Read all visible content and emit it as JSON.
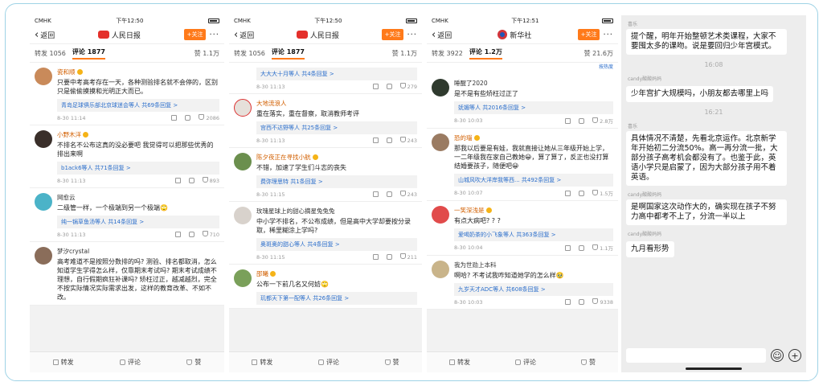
{
  "panels": [
    {
      "status": {
        "carrier": "CMHK",
        "time": "下午12:50"
      },
      "nav": {
        "back": "返回",
        "title": "人民日报",
        "follow": "+关注",
        "more": "···"
      },
      "tabs": {
        "repost": "转发 1056",
        "comment": "评论 1877",
        "likes": "赞 1.1万"
      },
      "comments": [
        {
          "user": "瓷和顺",
          "text": "只要中考高考存在一天，各种测验排名就不会停的，区别只是偷偷摸摸和光明正大而已。",
          "replies": "青岛足球俱乐部北京球迷会等人 共69条回复 >",
          "time": "8-30 11:14",
          "likes": "2086",
          "avatar": "#c98a5a"
        },
        {
          "user": "小野木洋",
          "text": "不排名不公布这真的没必要吧 我觉得可以把那些优秀的排出来啊",
          "replies": "b1ack6等人 共71条回复 >",
          "time": "8-30 11:13",
          "likes": "893",
          "avatar": "#3a2f2a"
        },
        {
          "user": "网愈云",
          "text": "二级管一样，一个极端到另一个极端🙄",
          "replies": "纯一锅草鱼汤等人 共14条回复 >",
          "time": "8-30 11:13",
          "likes": "710",
          "avatar": "#4bb3c8"
        },
        {
          "user": "梦汐crystal",
          "text": "高考难道不是按照分数排的吗? 测验、排名都取消，怎么知道学生学得怎么样，仅靠期末考试吗? 期末考试成绩不理想，自行假期疯狂补课吗? 矫枉过正，越减越烈，完全不按实际情况实际需求出发，这样的教育改革、不如不改。",
          "replies": "",
          "time": "",
          "likes": "",
          "avatar": "#8a6d5a"
        }
      ],
      "bottom": {
        "repost": "转发",
        "comment": "评论",
        "like": "赞"
      }
    },
    {
      "status": {
        "carrier": "CMHK",
        "time": "下午12:50"
      },
      "nav": {
        "back": "返回",
        "title": "人民日报",
        "follow": "+关注",
        "more": "···"
      },
      "tabs": {
        "repost": "转发 1056",
        "comment": "评论 1877",
        "likes": "赞 1.1万"
      },
      "comments": [
        {
          "user": "",
          "text": "",
          "replies": "大大大十月等人 共4条回复 >",
          "time": "8-30 11:13",
          "likes": "279",
          "avatar": ""
        },
        {
          "user": "大地流浪人",
          "text": "重在落实，重在督察，取消教师考评",
          "replies": "宫西不达野等人 共25条回复 >",
          "time": "8-30 11:13",
          "likes": "243",
          "avatar": "#e6e0da"
        },
        {
          "user": "陈夕夜正在寻找小航",
          "text": "不错，加速了学生们斗志的丧失",
          "replies": "费弥理思特 共1条回复 >",
          "time": "8-30 11:15",
          "likes": "243",
          "avatar": "#6b8f4e"
        },
        {
          "user": "玫瑰星球上的甜心摘星兔兔兔",
          "text": "中小学不排名，不公布成绩，但是高中大学却要按分录取，稀里糊涂上学吗?",
          "replies": "奥斑奥的甜心等人 共4条回复 >",
          "time": "8-30 11:15",
          "likes": "211",
          "avatar": "#d8d2cc"
        },
        {
          "user": "邵曦",
          "text": "公布一下前几名又何妨🙄",
          "replies": "玑都天下第一配等人 共26条回复 >",
          "time": "",
          "likes": "",
          "avatar": "#7aa05a"
        }
      ],
      "bottom": {
        "repost": "转发",
        "comment": "评论",
        "like": "赞"
      }
    },
    {
      "status": {
        "carrier": "CMHK",
        "time": "下午12:51"
      },
      "nav": {
        "back": "返回",
        "title": "新华社",
        "follow": "+关注",
        "more": "···"
      },
      "tabs": {
        "repost": "转发 3922",
        "comment": "评论 1.2万",
        "likes": "赞 21.6万"
      },
      "sort": "按热度",
      "comments": [
        {
          "user": "睡醒了2020",
          "text": "是不是有些矫枉过正了",
          "replies": "妩媚等人 共2016条回复 >",
          "time": "8-30 10:03",
          "likes": "2.8万",
          "avatar": "#2f3a2e"
        },
        {
          "user": "恐的瑙",
          "text": "那我以后要是有娃，我就直接让她从三年级开始上学，一二年级我在家自己教她😀，算了算了，反正也没打算结婚要孩子，随便吧😀",
          "replies": "山城风吹大洋岸我等西... 共492条回复 >",
          "time": "8-30 10:07",
          "likes": "1.5万",
          "avatar": "#9a7b62"
        },
        {
          "user": "一笑深浅是",
          "text": "有点大病吧? ? ?",
          "replies": "爱喝奶茶的小飞象等人 共363条回复 >",
          "time": "8-30 10:04",
          "likes": "1.1万",
          "avatar": "#e14b4b"
        },
        {
          "user": "我为世勋上本科",
          "text": "啊哈? 不考试我咋知道她学的怎么样🥹",
          "replies": "九岁天才ADC等人 共608条回复 >",
          "time": "8-30 10:03",
          "likes": "9338",
          "avatar": "#c9b48a"
        }
      ],
      "bottom": {
        "repost": "转发",
        "comment": "评论",
        "like": "赞"
      }
    }
  ],
  "chat": {
    "messages": [
      {
        "kind": "bubble",
        "sender": "",
        "text": "提个醒，明年开始整顿艺术类课程，大家不要囤太多的课吻。说是要回归少年宫模式。"
      },
      {
        "kind": "time",
        "text": "16:08"
      },
      {
        "kind": "bubble",
        "sender": "candy酸酸妈妈",
        "text": "少年宫扩大规模吗，小朋友都去哪里上吗"
      },
      {
        "kind": "time",
        "text": "16:21"
      },
      {
        "kind": "bubble",
        "sender": "喜乐",
        "text": "具体情况不清楚，先看北京运作。北京新学年开始初二分流50%。高一再分流一批，大部分孩子高考机会都没有了。也鉴于此，英语小学只是启蒙了，因为大部分孩子用不着英语。"
      },
      {
        "kind": "bubble",
        "sender": "candy酸酸妈妈",
        "text": "是啊国家这次动作大的，确实现在孩子不努力高中都考不上了，分流一半以上"
      },
      {
        "kind": "bubble",
        "sender": "candy酸酸妈妈",
        "text": "九月看形势"
      }
    ],
    "top_sender": "喜乐"
  }
}
